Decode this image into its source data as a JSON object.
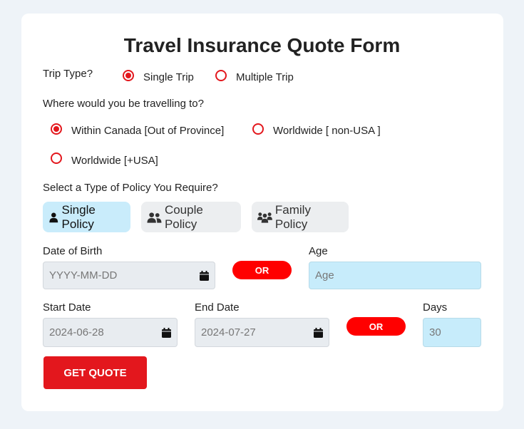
{
  "form": {
    "title": "Travel Insurance Quote Form",
    "trip_type_label": "Trip Type?",
    "trip_options": [
      {
        "label": "Single Trip",
        "selected": true
      },
      {
        "label": "Multiple Trip",
        "selected": false
      }
    ],
    "destination_label": "Where would you be travelling to?",
    "destination_options": [
      {
        "label": "Within Canada [Out of Province]",
        "selected": true
      },
      {
        "label": "Worldwide [ non-USA ]",
        "selected": false
      },
      {
        "label": "Worldwide [+USA]",
        "selected": false
      }
    ],
    "policy_label": "Select a Type of Policy You Require?",
    "policies": [
      {
        "label": "Single Policy",
        "icon": "user-icon",
        "active": true
      },
      {
        "label": "Couple Policy",
        "icon": "users-icon",
        "active": false
      },
      {
        "label": "Family Policy",
        "icon": "family-icon",
        "active": false
      }
    ],
    "dob_label": "Date of Birth",
    "dob_placeholder": "YYYY-MM-DD",
    "or_label": "OR",
    "age_label": "Age",
    "age_placeholder": "Age",
    "start_label": "Start Date",
    "start_value": "2024-06-28",
    "end_label": "End Date",
    "end_value": "2024-07-27",
    "days_label": "Days",
    "days_value": "30",
    "submit_label": "GET QUOTE"
  },
  "colors": {
    "accent": "#e3171d",
    "page_bg": "#eef3f8",
    "active_bg": "#c9ecfb"
  }
}
